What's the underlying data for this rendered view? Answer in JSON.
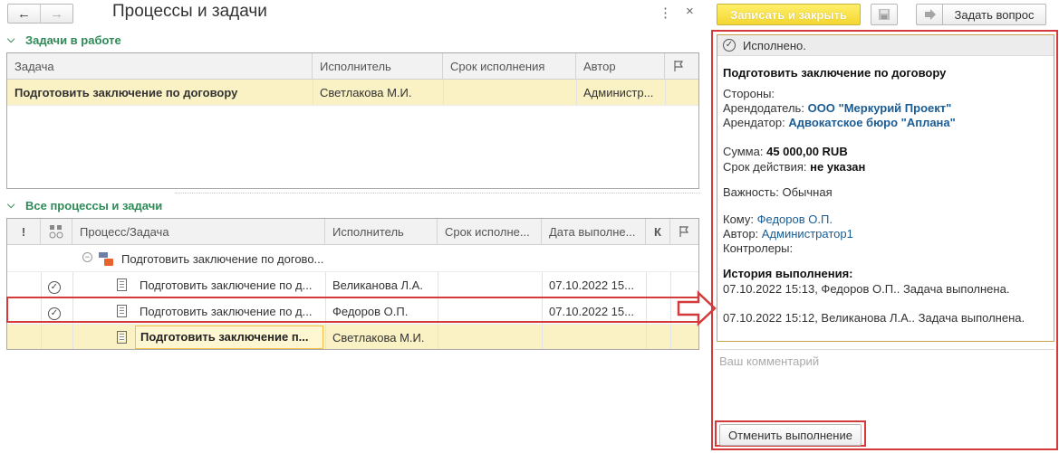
{
  "header": {
    "back_icon": "←",
    "forward_icon": "→",
    "title": "Процессы и задачи",
    "menu_icon": "⋮",
    "close_icon": "×"
  },
  "tasks_in_work": {
    "section_title": "Задачи в работе",
    "columns": [
      "Задача",
      "Исполнитель",
      "Срок исполнения",
      "Автор"
    ],
    "rows": [
      {
        "task": "Подготовить заключение по договору",
        "performer": "Светлакова М.И.",
        "deadline": "",
        "author": "Администр..."
      }
    ]
  },
  "all_processes": {
    "section_title": "Все процессы и задачи",
    "columns": {
      "importance": "!",
      "process": "Процесс/Задача",
      "performer": "Исполнитель",
      "deadline": "Срок исполне...",
      "done_date": "Дата выполне...",
      "k": "К"
    },
    "rows": [
      {
        "name": "Подготовить заключение по догово...",
        "performer": "",
        "deadline": "",
        "done_date": ""
      },
      {
        "name": "Подготовить заключение по д...",
        "performer": "Великанова Л.А.",
        "deadline": "",
        "done_date": "07.10.2022 15..."
      },
      {
        "name": "Подготовить заключение по д...",
        "performer": "Федоров О.П.",
        "deadline": "",
        "done_date": "07.10.2022 15..."
      },
      {
        "name": "Подготовить заключение п...",
        "performer": "Светлакова М.И.",
        "deadline": "",
        "done_date": ""
      }
    ]
  },
  "right_panel": {
    "write_close_label": "Записать и закрыть",
    "ask_question_label": "Задать вопрос",
    "status": "Исполнено.",
    "task_title": "Подготовить заключение по договору",
    "parties_label": "Стороны:",
    "lessor_label": "Арендодатель:",
    "lessor_value": "ООО \"Меркурий Проект\"",
    "lessee_label": "Арендатор:",
    "lessee_value": "Адвокатское бюро \"Аплана\"",
    "sum_label": "Сумма:",
    "sum_value": "45 000,00 RUB",
    "validity_label": "Срок действия:",
    "validity_value": "не указан",
    "importance_label": "Важность:",
    "importance_value": "Обычная",
    "to_label": "Кому:",
    "to_value": "Федоров О.П.",
    "author_label": "Автор:",
    "author_value": "Администратор1",
    "controllers_label": "Контролеры:",
    "history_title": "История выполнения:",
    "history": [
      "07.10.2022 15:13, Федоров О.П.. Задача выполнена.",
      "07.10.2022 15:12, Великанова Л.А.. Задача выполнена."
    ],
    "comment_placeholder": "Ваш комментарий",
    "cancel_label": "Отменить выполнение"
  },
  "colors": {
    "accent_green": "#2e8b57",
    "highlight_red": "#d43a3a",
    "selection_yellow": "#faf1c4",
    "primary_button": "#f3d631",
    "link_blue": "#1a5c94"
  }
}
